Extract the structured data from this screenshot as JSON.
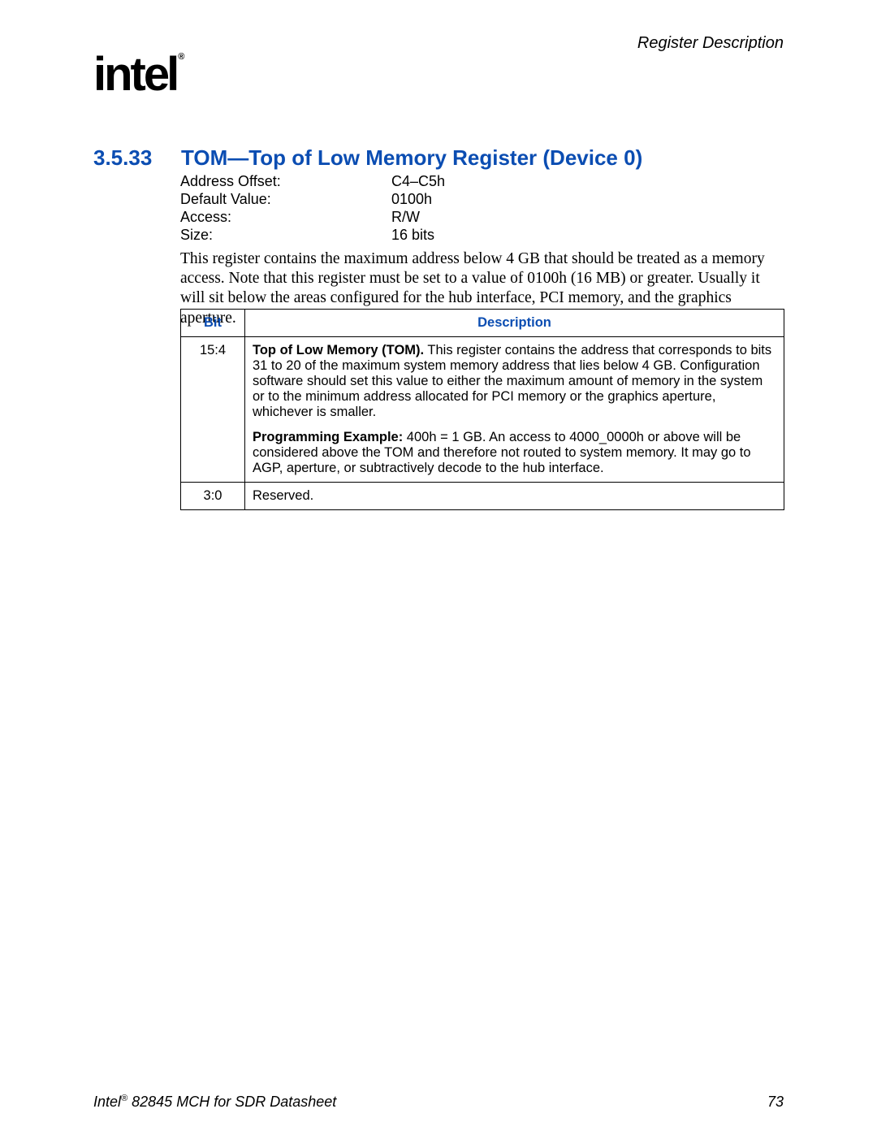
{
  "header": {
    "right": "Register Description"
  },
  "logo": {
    "text": "intel",
    "reg": "®"
  },
  "section": {
    "number": "3.5.33",
    "title": "TOM—Top of Low Memory Register (Device 0)"
  },
  "props": {
    "rows": [
      {
        "label": "Address Offset:",
        "value": "C4–C5h"
      },
      {
        "label": "Default Value:",
        "value": "0100h"
      },
      {
        "label": "Access:",
        "value": "R/W"
      },
      {
        "label": "Size:",
        "value": "16 bits"
      }
    ]
  },
  "body": "This register contains the maximum address below 4 GB that should be treated as a memory access. Note that this register must be set to a value of 0100h (16 MB) or greater. Usually it will sit below the areas configured for the hub interface, PCI memory, and the graphics aperture.",
  "table": {
    "headers": {
      "bit": "Bit",
      "desc": "Description"
    },
    "rows": [
      {
        "bit": "15:4",
        "desc1_bold": "Top of Low Memory (TOM).",
        "desc1_rest": " This register contains the address that corresponds to bits 31 to 20 of the maximum system memory address that lies below 4 GB. Configuration software should set this value to either the maximum amount of memory in the system or to the minimum address allocated for PCI memory or the graphics aperture, whichever is smaller.",
        "desc2_bold": "Programming Example:",
        "desc2_rest": " 400h = 1 GB. An access to 4000_0000h or above will be considered above the TOM and therefore not routed to system memory. It may go to AGP, aperture, or subtractively decode to the hub interface."
      },
      {
        "bit": "3:0",
        "desc1_bold": "",
        "desc1_rest": "Reserved.",
        "desc2_bold": "",
        "desc2_rest": ""
      }
    ]
  },
  "footer": {
    "left_pre": "Intel",
    "left_sup": "®",
    "left_post": " 82845 MCH for SDR Datasheet",
    "page": "73"
  }
}
